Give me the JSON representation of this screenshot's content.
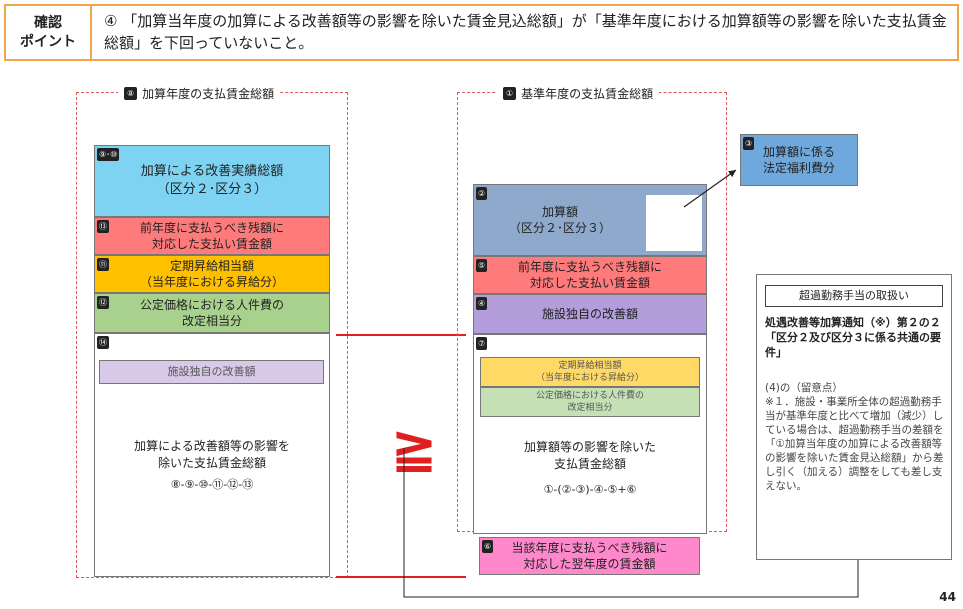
{
  "header": {
    "label_line1": "確認",
    "label_line2": "ポイント",
    "text": "④ 「加算当年度の加算による改善額等の影響を除いた賃金見込総額」が「基準年度における加算額等の影響を除いた支払賃金総額」を下回っていないこと。"
  },
  "left": {
    "frame_num": "⑧",
    "frame_title": "加算年度の支払賃金総額",
    "b1": {
      "num": "⑨･⑩",
      "line1": "加算による改善実績総額",
      "line2": "（区分２･区分３）"
    },
    "b2": {
      "num": "⑬",
      "line1": "前年度に支払うべき残額に",
      "line2": "対応した支払い賃金額"
    },
    "b3": {
      "num": "⑪",
      "line1": "定期昇給相当額",
      "line2": "（当年度における昇給分）"
    },
    "b4": {
      "num": "⑫",
      "line1": "公定価格における人件費の",
      "line2": "改定相当分"
    },
    "b5": {
      "num": "⑭",
      "inner": "施設独自の改善額",
      "line1": "加算による改善額等の影響を",
      "line2": "除いた支払賃金総額",
      "formula": "⑧-⑨-⑩-⑪-⑫-⑬"
    }
  },
  "compare_symbol": "≧",
  "right": {
    "frame_num": "①",
    "frame_title": "基準年度の支払賃金総額",
    "b1": {
      "num": "②",
      "line1": "加算額",
      "line2": "（区分２･区分３）"
    },
    "b2": {
      "num": "⑤",
      "line1": "前年度に支払うべき残額に",
      "line2": "対応した支払い賃金額"
    },
    "b3": {
      "num": "④",
      "line1": "施設独自の改善額"
    },
    "b4": {
      "num": "⑦",
      "inner1_line1": "定期昇給相当額",
      "inner1_line2": "（当年度における昇給分）",
      "inner2_line1": "公定価格における人件費の",
      "inner2_line2": "改定相当分",
      "line1": "加算額等の影響を除いた",
      "line2": "支払賃金総額",
      "formula": "①-(②-③)-④-⑤+⑥"
    },
    "b5": {
      "num": "⑥",
      "line1": "当該年度に支払うべき残額に",
      "line2": "対応した翌年度の賃金額"
    }
  },
  "welfare": {
    "num": "③",
    "line1": "加算額に係る",
    "line2": "法定福利費分"
  },
  "overtime": {
    "title": "超過勤務手当の取扱い",
    "heading": "処遇改善等加算通知（※）第２の２「区分２及び区分３に係る共通の要件」",
    "sub": "(4)の（留意点）",
    "note": "※１．施設・事業所全体の超過勤務手当が基準年度と比べて増加（減少）している場合は、超過勤務手当の差額を「①加算当年度の加算による改善額等の影響を除いた賃金見込総額」から差し引く（加える）調整をしても差し支えない。"
  },
  "page_number": "44",
  "colors": {
    "accent": "#f0a54a",
    "dash": "#e05555",
    "sky": "#7fd3f2",
    "salmon": "#ff7b7b",
    "amber": "#ffc000",
    "green": "#a9d18e",
    "lavender": "#d9c9e8",
    "steel": "#8ea9cc",
    "purple": "#b39ddb",
    "pink": "#ff88cc",
    "blue": "#6fa8dc"
  }
}
